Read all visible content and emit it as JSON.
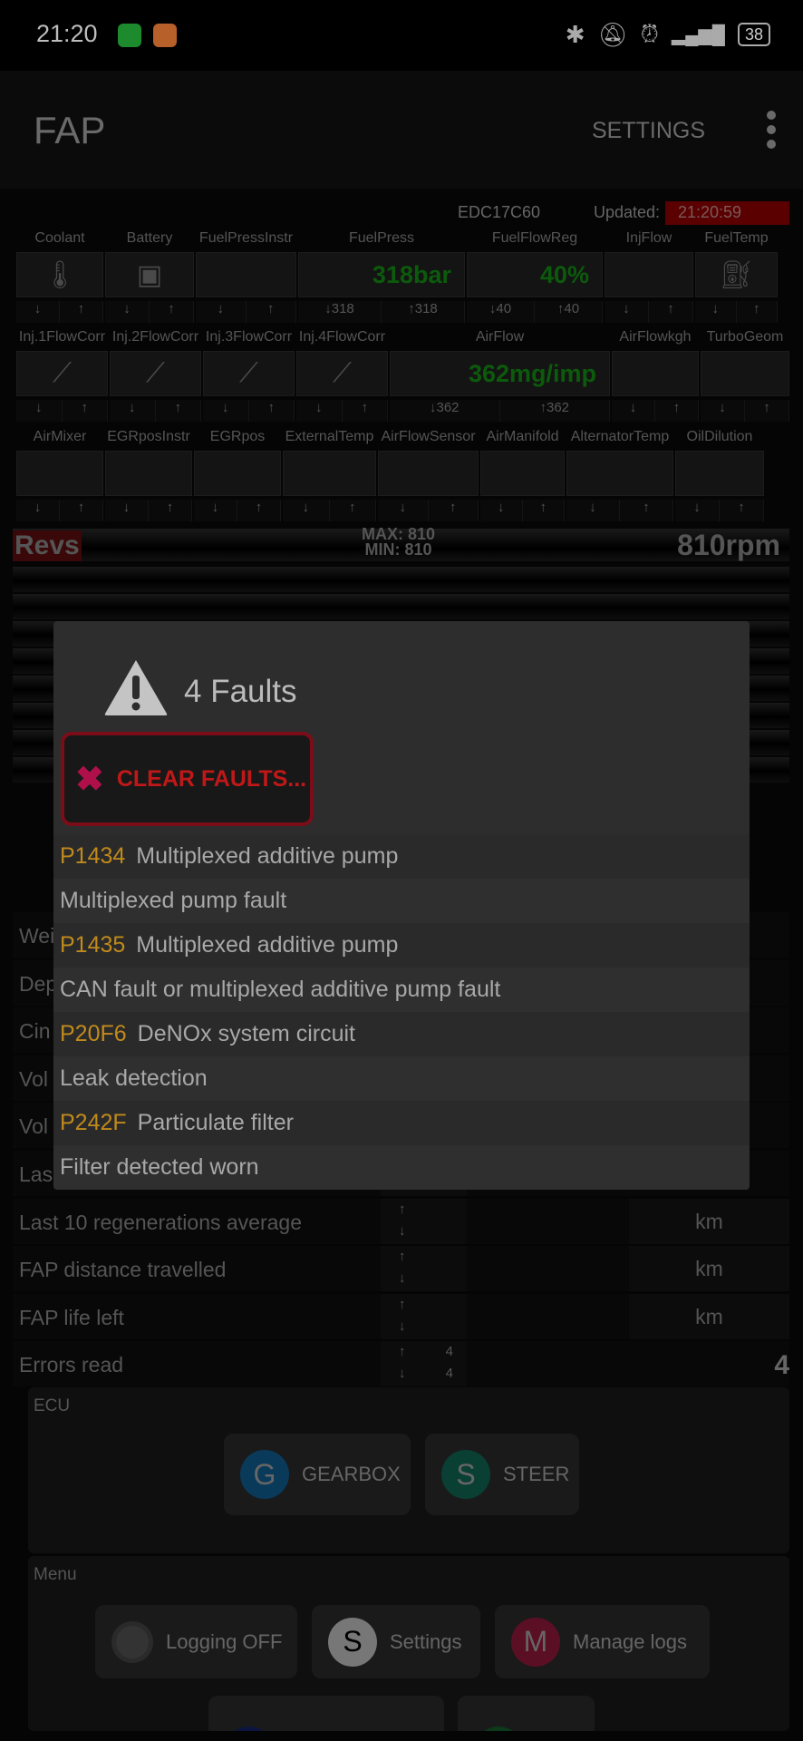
{
  "status": {
    "time": "21:20",
    "battery": "38",
    "icons": [
      "whatsapp-icon",
      "health-icon",
      "bluetooth-icon",
      "bell-off-icon",
      "alarm-icon",
      "signal-icon",
      "battery-icon"
    ]
  },
  "appbar": {
    "title": "FAP",
    "settings": "SETTINGS"
  },
  "ecu": {
    "name": "EDC17C60",
    "updated_label": "Updated:",
    "updated_time": "21:20:59"
  },
  "gauge_rows": [
    [
      {
        "label": "Coolant",
        "icon": "coolant-icon"
      },
      {
        "label": "Battery",
        "icon": "battery-icon"
      },
      {
        "label": "FuelPressInstr"
      },
      {
        "label": "FuelPress",
        "value": "318bar",
        "min": "318",
        "max": "318"
      },
      {
        "label": "FuelFlowReg",
        "value": "40%",
        "min": "40",
        "max": "40"
      },
      {
        "label": "InjFlow"
      },
      {
        "label": "FuelTemp",
        "icon": "fuel-pump-icon"
      }
    ],
    [
      {
        "label": "Inj.1FlowCorr",
        "icon": "injector-icon"
      },
      {
        "label": "Inj.2FlowCorr",
        "icon": "injector-icon"
      },
      {
        "label": "Inj.3FlowCorr",
        "icon": "injector-icon"
      },
      {
        "label": "Inj.4FlowCorr",
        "icon": "injector-icon"
      },
      {
        "label": "AirFlow",
        "value": "362mg/imp",
        "min": "362",
        "max": "362"
      },
      {
        "label": "AirFlowkgh"
      },
      {
        "label": "TurboGeom"
      }
    ],
    [
      {
        "label": "AirMixer"
      },
      {
        "label": "EGRposInstr"
      },
      {
        "label": "EGRpos"
      },
      {
        "label": "ExternalTemp"
      },
      {
        "label": "AirFlowSensor"
      },
      {
        "label": "AirManifold"
      },
      {
        "label": "AlternatorTemp"
      },
      {
        "label": "OilDilution"
      }
    ]
  ],
  "revs": {
    "label": "Revs",
    "max": "MAX: 810",
    "min": "MIN: 810",
    "value": "810rpm"
  },
  "list": [
    {
      "label": "Wei"
    },
    {
      "label": "Dep"
    },
    {
      "label": "Cin"
    },
    {
      "label": "Vol"
    },
    {
      "label": "Vol"
    },
    {
      "label": "Las"
    },
    {
      "label": "Last 10 regenerations average",
      "unit": "km"
    },
    {
      "label": "FAP distance travelled",
      "unit": "km"
    },
    {
      "label": "FAP life left",
      "unit": "km"
    },
    {
      "label": "Errors read",
      "max": "4",
      "min": "4",
      "value": "4"
    }
  ],
  "ecu_panel": {
    "title": "ECU",
    "buttons": [
      {
        "letter": "G",
        "label": "GEARBOX",
        "color": "#0a3a5a"
      },
      {
        "letter": "S",
        "label": "STEER",
        "color": "#0a3f33"
      }
    ]
  },
  "menu_panel": {
    "title": "Menu",
    "buttons": [
      {
        "letter": "",
        "label": "Logging OFF",
        "color": "#3a3a3a"
      },
      {
        "letter": "S",
        "label": "Settings",
        "color": "#777777"
      },
      {
        "letter": "M",
        "label": "Manage logs",
        "color": "#5a0f25"
      }
    ]
  },
  "dialog": {
    "title": "4 Faults",
    "clear_label": "CLEAR FAULTS...",
    "faults": [
      {
        "code": "P1434",
        "name": "Multiplexed additive pump",
        "detail": "Multiplexed pump fault"
      },
      {
        "code": "P1435",
        "name": "Multiplexed additive pump",
        "detail": "CAN fault or multiplexed additive pump fault"
      },
      {
        "code": "P20F6",
        "name": "DeNOx system circuit",
        "detail": "Leak detection"
      },
      {
        "code": "P242F",
        "name": "Particulate filter",
        "detail": "Filter detected worn"
      }
    ]
  },
  "colors": {
    "fault_code": "#c08a1c",
    "clear_button": "#c01818",
    "gauge_value": "#0c5a0c"
  }
}
